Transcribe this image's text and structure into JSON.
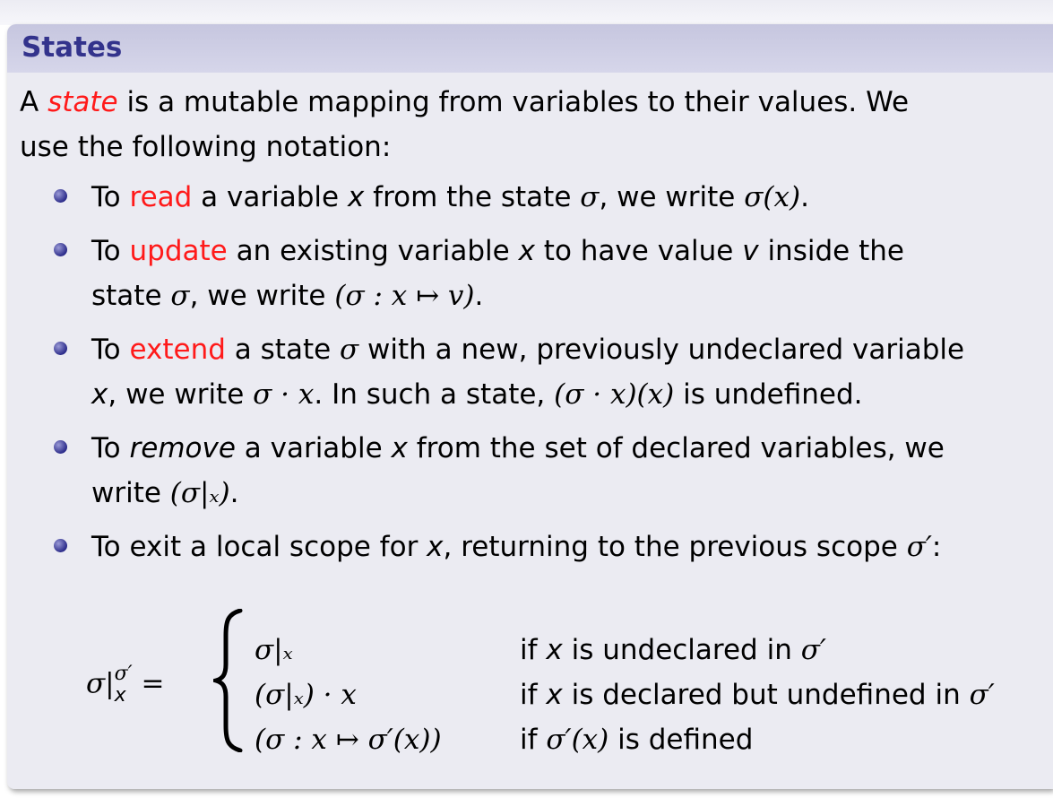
{
  "block": {
    "title": "States",
    "intro": {
      "pre": "A ",
      "em": "state",
      "post1": " is a mutable mapping from variables to their values. We",
      "post2": "use the following notation:"
    },
    "items": [
      {
        "l1_a": "To ",
        "l1_red": "read",
        "l1_b": " a variable ",
        "l1_x": "x",
        "l1_c": " from the state ",
        "l1_sigma": "σ",
        "l1_d": ", we write ",
        "l1_math": "σ(x)",
        "l1_e": "."
      },
      {
        "l1_a": "To ",
        "l1_red": "update",
        "l1_b": " an existing variable ",
        "l1_x": "x",
        "l1_c": " to have value ",
        "l1_v": "v",
        "l1_d": " inside the",
        "l2_a": "state ",
        "l2_sigma": "σ",
        "l2_b": ", we write ",
        "l2_math": "(σ : x ↦ v)",
        "l2_c": "."
      },
      {
        "l1_a": "To ",
        "l1_red": "extend",
        "l1_b": " a state ",
        "l1_sigma": "σ",
        "l1_c": " with a new, previously undeclared variable",
        "l2_x": "x",
        "l2_a": ", we write ",
        "l2_math1": "σ · x",
        "l2_b": ". In such a state, ",
        "l2_math2": "(σ · x)(x)",
        "l2_c": " is undefined."
      },
      {
        "l1_a": "To ",
        "l1_em": "remove",
        "l1_b": " a variable ",
        "l1_x": "x",
        "l1_c": " from the set of declared variables, we",
        "l2_a": "write ",
        "l2_math": "(σ|ₓ)",
        "l2_b": "."
      },
      {
        "l1_a": "To exit a local scope for ",
        "l1_x": "x",
        "l1_b": ", returning to the previous scope ",
        "l1_math": "σ′",
        "l1_c": ":"
      }
    ],
    "formula": {
      "lhs_sigma": "σ|",
      "lhs_sup": "σ′",
      "lhs_sub": "x",
      "eq": " =",
      "cases": [
        {
          "expr": "σ|ₓ",
          "cond_a": "if ",
          "cond_x": "x",
          "cond_b": " is undeclared in ",
          "cond_c": "σ′"
        },
        {
          "expr": "(σ|ₓ) · x",
          "cond_a": "if ",
          "cond_x": "x",
          "cond_b": " is declared but undefined in ",
          "cond_c": "σ′"
        },
        {
          "expr": "(σ : x ↦ σ′(x))",
          "cond_a": "if ",
          "cond_x": "σ′(x)",
          "cond_b": " is defined",
          "cond_c": ""
        }
      ]
    }
  },
  "colors": {
    "title": "#33338c",
    "title_bg": "#c6c6df",
    "body_bg": "#ebebf2",
    "highlight": "#ff1a1a"
  },
  "icons": {
    "bullet": "ball-bullet-icon"
  }
}
